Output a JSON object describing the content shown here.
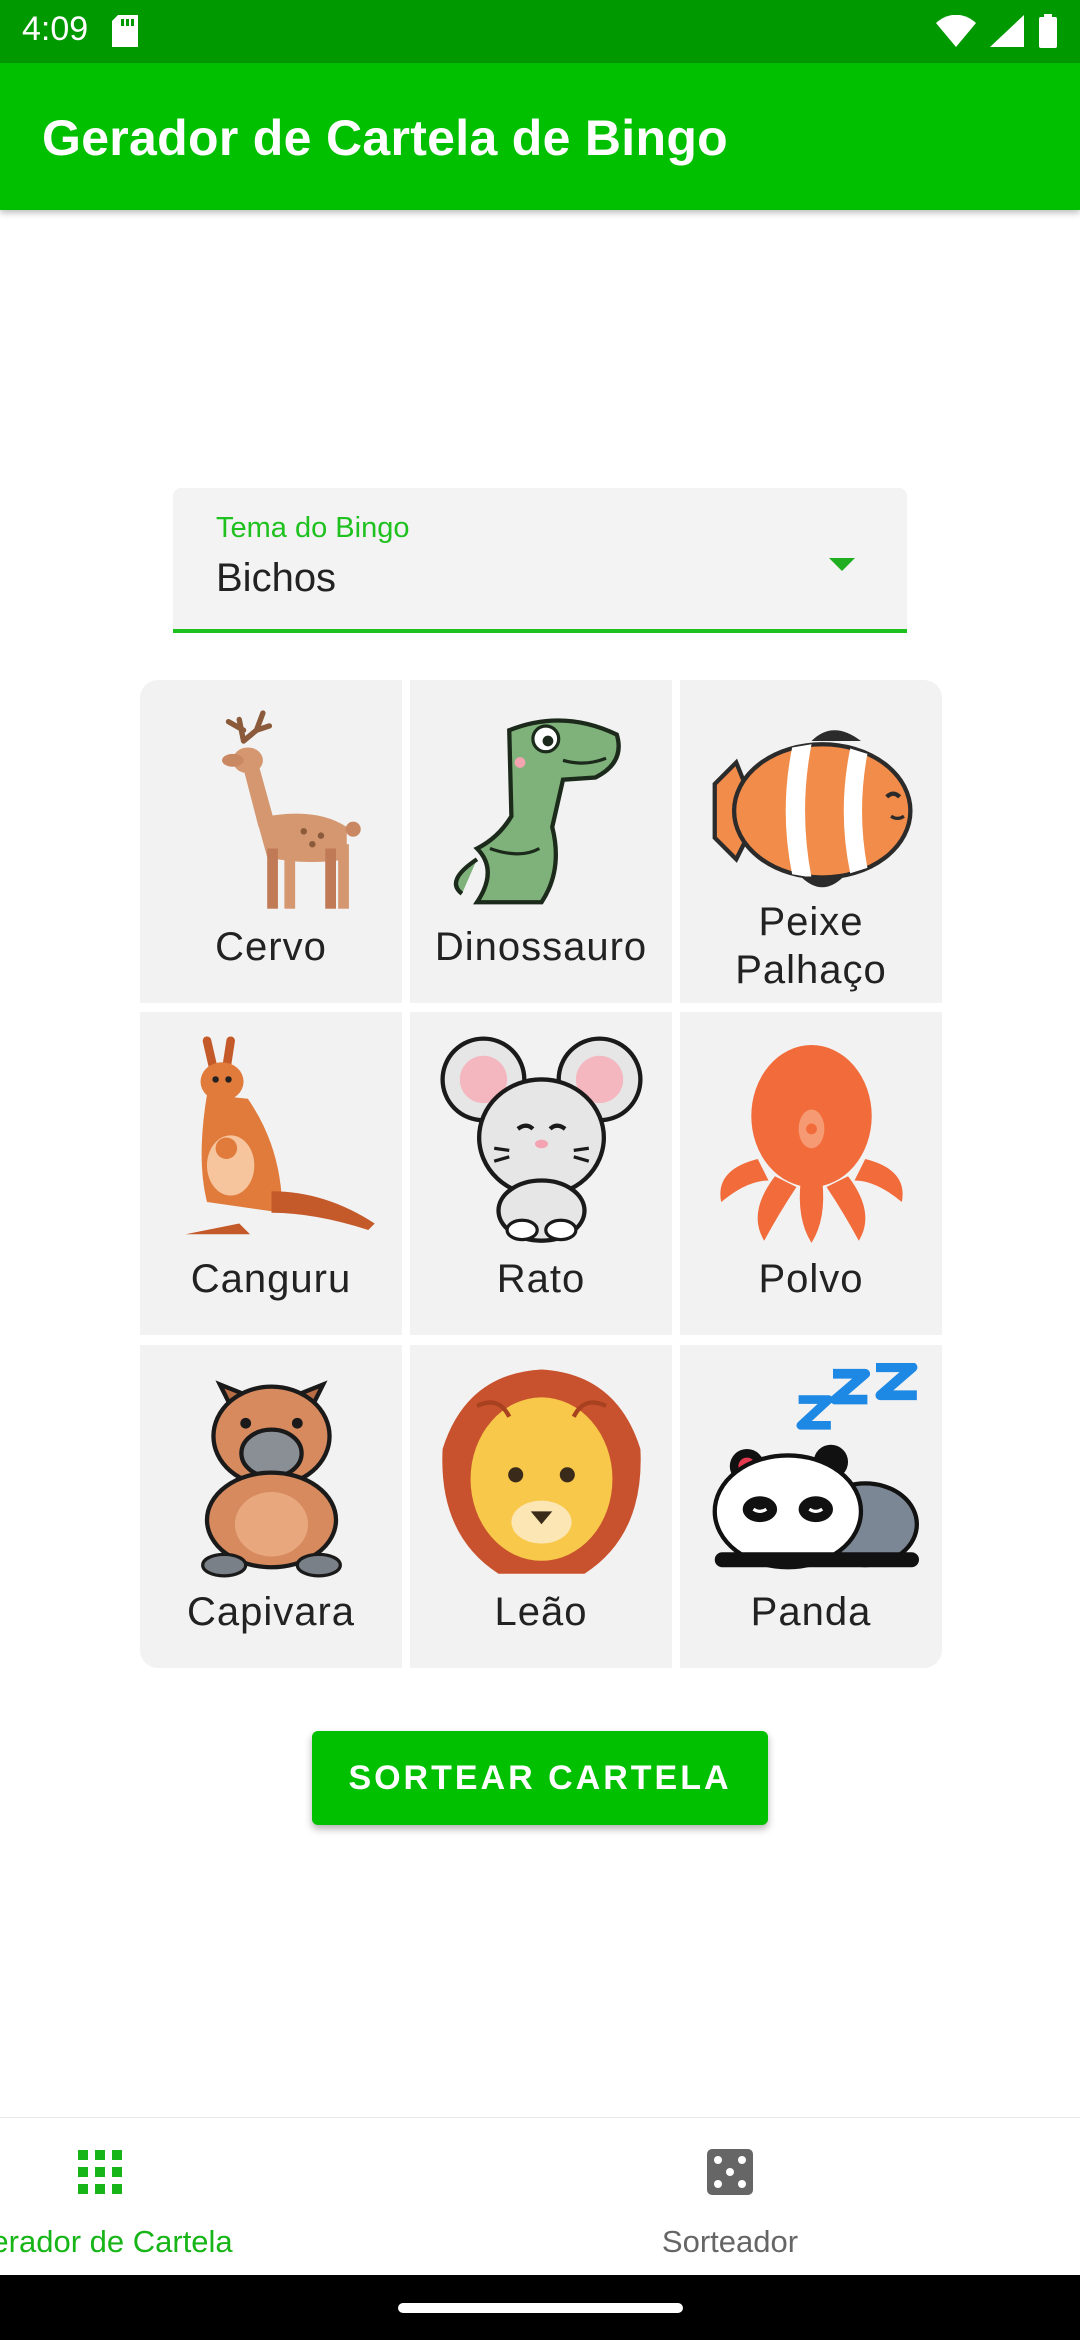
{
  "status_bar": {
    "time": "4:09"
  },
  "app_bar": {
    "title": "Gerador de Cartela de Bingo"
  },
  "theme_select": {
    "label": "Tema do Bingo",
    "value": "Bichos"
  },
  "cards": [
    {
      "name": "Cervo",
      "icon": "deer-icon"
    },
    {
      "name": "Dinossauro",
      "icon": "dinosaur-icon"
    },
    {
      "name": "Peixe\nPalhaço",
      "line1": "Peixe",
      "line2": "Palhaço",
      "icon": "clownfish-icon"
    },
    {
      "name": "Canguru",
      "icon": "kangaroo-icon"
    },
    {
      "name": "Rato",
      "icon": "mouse-icon"
    },
    {
      "name": "Polvo",
      "icon": "octopus-icon"
    },
    {
      "name": "Capivara",
      "icon": "capybara-icon"
    },
    {
      "name": "Leão",
      "icon": "lion-icon"
    },
    {
      "name": "Panda",
      "icon": "panda-icon"
    }
  ],
  "actions": {
    "draw_button": "SORTEAR CARTELA"
  },
  "bottom_nav": [
    {
      "label": "Gerador de Cartela",
      "icon": "grid-icon",
      "active": true
    },
    {
      "label": "Sorteador",
      "icon": "dice-icon",
      "active": false
    }
  ],
  "colors": {
    "primary": "#00c000",
    "status_bar": "#009900",
    "accent": "#1fc11f"
  }
}
